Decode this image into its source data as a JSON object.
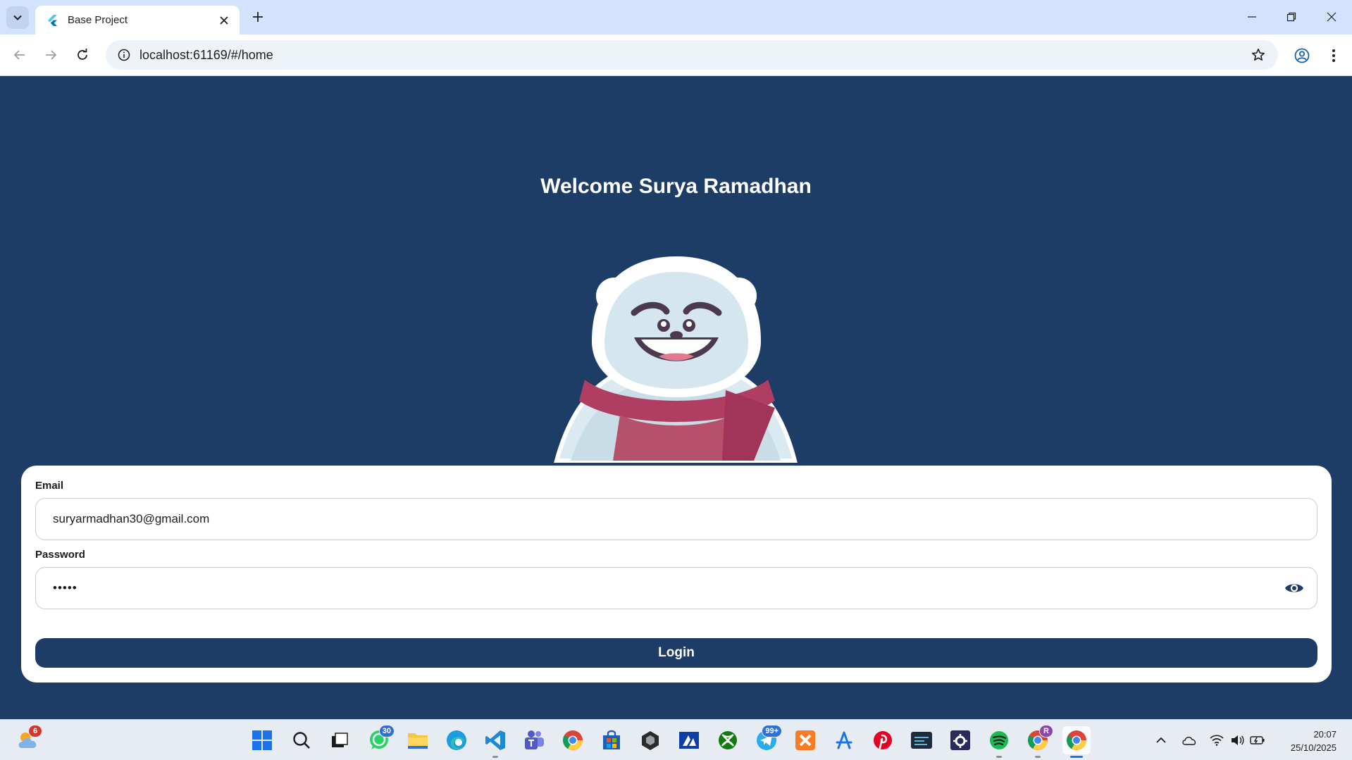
{
  "browser": {
    "tab_title": "Base Project",
    "url": "localhost:61169/#/home"
  },
  "app": {
    "welcome_text": "Welcome Surya Ramadhan",
    "email_label": "Email",
    "email_value": "suryarmadhan30@gmail.com",
    "password_label": "Password",
    "password_masked": "•••••",
    "login_label": "Login",
    "colors": {
      "primary": "#1e3d66",
      "card": "#ffffff"
    }
  },
  "taskbar": {
    "weather_badge": "6",
    "whatsapp_badge": "30",
    "telegram_badge": "99+",
    "chrome_profile_badge": "R",
    "time": "20:07",
    "date": "25/10/2025",
    "apps": [
      "weather-widget",
      "start",
      "search",
      "task-view",
      "whatsapp",
      "file-explorer",
      "edge",
      "vscode",
      "teams",
      "chrome",
      "microsoft-store",
      "unity",
      "azure-data-studio",
      "xbox",
      "telegram",
      "xampp",
      "copilot-apps",
      "pinterest",
      "terminal-app",
      "settings-app",
      "spotify",
      "chrome-profile",
      "chrome-active"
    ]
  }
}
